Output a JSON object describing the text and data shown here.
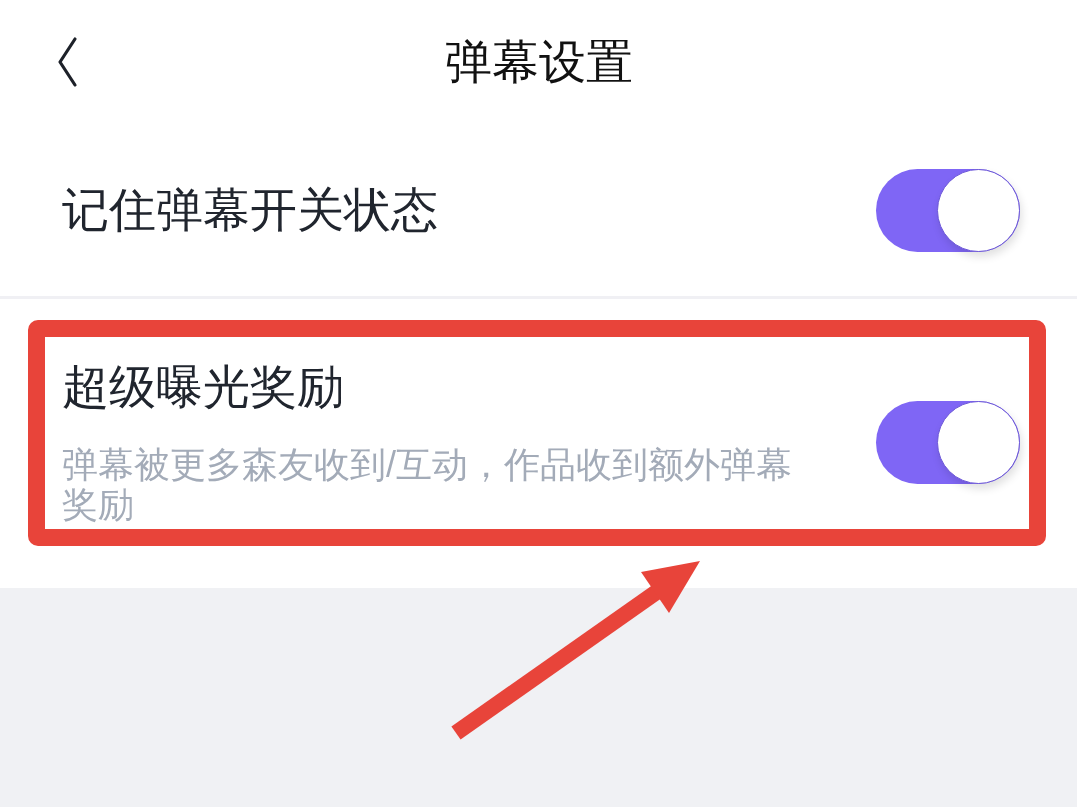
{
  "header": {
    "title": "弹幕设置"
  },
  "settings": [
    {
      "title": "记住弹幕开关状态",
      "on": true,
      "highlighted": false
    },
    {
      "title": "超级曝光奖励",
      "description": "弹幕被更多森友收到/互动，作品收到额外弹幕奖励",
      "on": true,
      "highlighted": true
    }
  ]
}
